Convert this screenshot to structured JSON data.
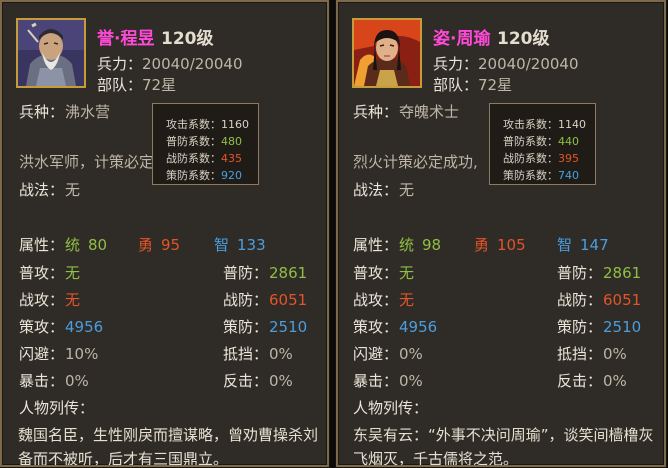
{
  "panels": [
    {
      "name": "誉·程昱",
      "level": "120级",
      "hp_label": "兵力：",
      "hp": "20040/20040",
      "unit_label": "部队：",
      "unit": "72星",
      "troop_label": "兵种：",
      "troop": "沸水营",
      "desc": "洪水军师，计策必定",
      "tactic_label": "战法：",
      "tactic": "无",
      "attr_label": "属性：",
      "tong_label": "统",
      "tong": "80",
      "yong_label": "勇",
      "yong": "95",
      "zhi_label": "智",
      "zhi": "133",
      "patk_label": "普攻：",
      "patk": "无",
      "pdef_label": "普防：",
      "pdef": "2861",
      "watk_label": "战攻：",
      "watk": "无",
      "wdef_label": "战防：",
      "wdef": "6051",
      "satk_label": "策攻：",
      "satk": "4956",
      "sdef_label": "策防：",
      "sdef": "2510",
      "dodge_label": "闪避：",
      "dodge": "10%",
      "block_label": "抵挡：",
      "block": "0%",
      "crit_label": "暴击：",
      "crit": "0%",
      "counter_label": "反击：",
      "counter": "0%",
      "bio_label": "人物列传：",
      "bio": "魏国名臣，生性刚戾而擅谋略，曾劝曹操杀刘备而不被听，后才有三国鼎立。",
      "tooltip": {
        "atk_label": "攻击系数：",
        "atk": "1160",
        "pdef_label": "普防系数：",
        "pdef": "480",
        "wdef_label": "战防系数：",
        "wdef": "435",
        "sdef_label": "策防系数：",
        "sdef": "920"
      }
    },
    {
      "name": "姿·周瑜",
      "level": "120级",
      "hp_label": "兵力：",
      "hp": "20040/20040",
      "unit_label": "部队：",
      "unit": "72星",
      "troop_label": "兵种：",
      "troop": "夺魄术士",
      "desc": "烈火计策必定成功,",
      "tactic_label": "战法：",
      "tactic": "无",
      "attr_label": "属性：",
      "tong_label": "统",
      "tong": "98",
      "yong_label": "勇",
      "yong": "105",
      "zhi_label": "智",
      "zhi": "147",
      "patk_label": "普攻：",
      "patk": "无",
      "pdef_label": "普防：",
      "pdef": "2861",
      "watk_label": "战攻：",
      "watk": "无",
      "wdef_label": "战防：",
      "wdef": "6051",
      "satk_label": "策攻：",
      "satk": "4956",
      "sdef_label": "策防：",
      "sdef": "2510",
      "dodge_label": "闪避：",
      "dodge": "0%",
      "block_label": "抵挡：",
      "block": "0%",
      "crit_label": "暴击：",
      "crit": "0%",
      "counter_label": "反击：",
      "counter": "0%",
      "bio_label": "人物列传：",
      "bio": "东吴有云：“外事不决问周瑜”，谈笑间樯橹灰飞烟灭，千古儒将之范。",
      "tooltip": {
        "atk_label": "攻击系数：",
        "atk": "1140",
        "pdef_label": "普防系数：",
        "pdef": "440",
        "wdef_label": "战防系数：",
        "wdef": "395",
        "sdef_label": "策防系数：",
        "sdef": "740"
      }
    }
  ],
  "colors": {
    "name": "#ff4ad8",
    "green": "#8fbf46",
    "red": "#e3542a",
    "blue": "#4a9ee0",
    "frame": "#7c6a4b"
  }
}
